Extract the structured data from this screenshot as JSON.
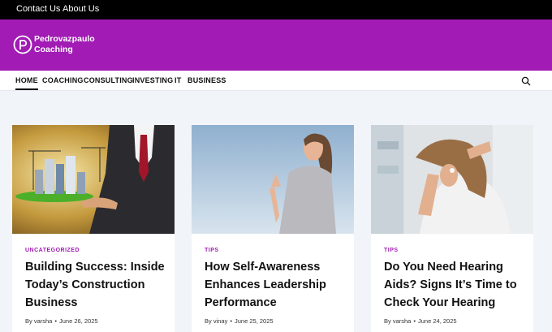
{
  "topbar": {
    "links": [
      "Contact Us",
      "About Us"
    ]
  },
  "brand": {
    "line1": "Pedrovazpaulo",
    "line2": "Coaching"
  },
  "nav": {
    "items": [
      "HOME",
      "COACHING",
      "CONSULTING",
      "INVESTING",
      "IT",
      "BUSINESS"
    ],
    "active": "HOME",
    "search_icon": "search-icon"
  },
  "colors": {
    "brand": "#a11bb4",
    "topbar": "#000000",
    "page_bg": "#f1f5f9"
  },
  "posts": [
    {
      "category": "UNCATEGORIZED",
      "title": "Building Success: Inside Today’s Construction Business",
      "author": "By varsha",
      "date": "June 26, 2025"
    },
    {
      "category": "TIPS",
      "title": "How Self-Awareness Enhances Leadership Performance",
      "author": "By vinay",
      "date": "June 25, 2025"
    },
    {
      "category": "TIPS",
      "title": "Do You Need Hearing Aids? Signs It’s Time to Check Your Hearing",
      "author": "By varsha",
      "date": "June 24, 2025"
    }
  ]
}
